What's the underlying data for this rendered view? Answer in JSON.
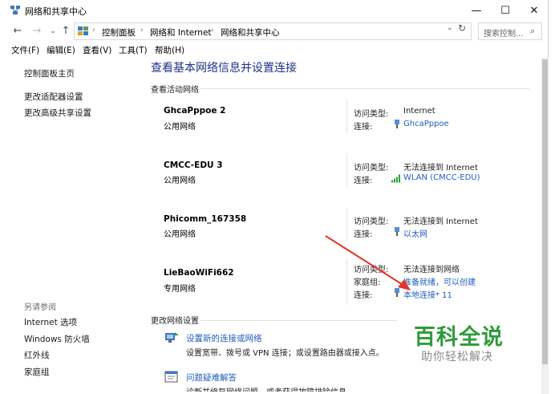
{
  "window": {
    "title": "网络和共享中心",
    "controls": {
      "minimize": "—",
      "maximize": "☐",
      "close": "✕"
    }
  },
  "address": {
    "back": "←",
    "forward": "→",
    "recent": "⌄",
    "up": "↑",
    "breadcrumbs": [
      "控制面板",
      "网络和 Internet",
      "网络和共享中心"
    ],
    "search_placeholder": "搜索控制...",
    "dropdown": "⌄",
    "refresh": "↻",
    "search_icon": "⌕",
    "sep": "›"
  },
  "menubar": [
    "文件(F)",
    "编辑(E)",
    "查看(V)",
    "工具(T)",
    "帮助(H)"
  ],
  "leftpane": {
    "links": [
      "控制面板主页",
      "更改适配器设置",
      "更改高级共享设置"
    ],
    "see_also_title": "另请参阅",
    "see_also": [
      "Internet 选项",
      "Windows 防火墙",
      "红外线",
      "家庭组"
    ]
  },
  "main": {
    "title": "查看基本网络信息并设置连接",
    "active_networks_label": "查看活动网络",
    "labels": {
      "access": "访问类型:",
      "connection": "连接:",
      "homegroup": "家庭组:"
    },
    "networks": [
      {
        "name": "GhcaPppoe  2",
        "type": "公用网络",
        "access": "Internet",
        "connection": "GhcaPppoe",
        "connection_icon": "ethernet-icon"
      },
      {
        "name": "CMCC-EDU  3",
        "type": "公用网络",
        "access": "无法连接到 Internet",
        "connection": "WLAN (CMCC-EDU)",
        "connection_icon": "wifi-signal-icon"
      },
      {
        "name": "Phicomm_167358",
        "type": "公用网络",
        "access": "无法连接到 Internet",
        "connection": "以太网",
        "connection_icon": "ethernet-icon"
      },
      {
        "name": "LieBaoWiFi662",
        "type": "专用网络",
        "access": "无法连接到网络",
        "homegroup": "准备就绪，可以创建",
        "connection": "本地连接* 11",
        "connection_icon": "ethernet-icon"
      }
    ],
    "change_settings_label": "更改网络设置",
    "tasks": [
      {
        "link": "设置新的连接或网络",
        "desc": "设置宽带、拨号或 VPN 连接；或设置路由器或接入点。",
        "icon": "new-connection-icon"
      },
      {
        "link": "问题疑难解答",
        "desc": "诊断并修复网络问题，或者获得故障排除信息。",
        "icon": "troubleshoot-icon"
      }
    ]
  },
  "watermark": {
    "title": "百科全说",
    "subtitle": "助你轻松解决"
  },
  "colors": {
    "link": "#1f5dbf",
    "title": "#1e3287",
    "watermark": "#2f9b3a",
    "arrow": "#e0352b"
  }
}
